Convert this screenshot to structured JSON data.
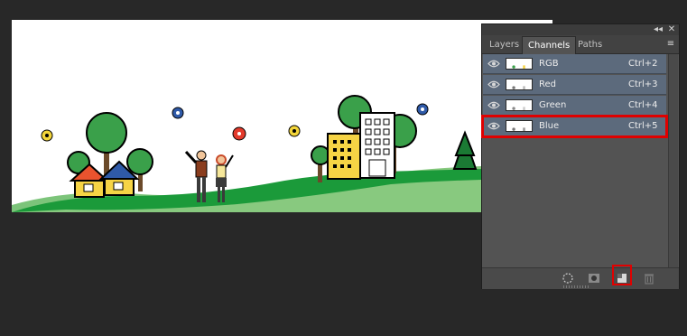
{
  "panel": {
    "tabs": [
      {
        "label": "Layers",
        "active": false
      },
      {
        "label": "Channels",
        "active": true
      },
      {
        "label": "Paths",
        "active": false
      }
    ],
    "collapse_glyph": "◂◂",
    "close_glyph": "✕",
    "menu_glyph": "≡",
    "channels": [
      {
        "name": "RGB",
        "shortcut": "Ctrl+2",
        "visible": true,
        "highlighted": false
      },
      {
        "name": "Red",
        "shortcut": "Ctrl+3",
        "visible": true,
        "highlighted": false
      },
      {
        "name": "Green",
        "shortcut": "Ctrl+4",
        "visible": true,
        "highlighted": false
      },
      {
        "name": "Blue",
        "shortcut": "Ctrl+5",
        "visible": true,
        "highlighted": true
      }
    ],
    "bottom_buttons": [
      {
        "icon": "load-selection-icon"
      },
      {
        "icon": "save-selection-icon"
      },
      {
        "icon": "new-channel-icon",
        "highlighted": true
      },
      {
        "icon": "trash-icon"
      }
    ]
  },
  "colors": {
    "app_bg": "#282828",
    "panel_bg": "#535353",
    "row_selected": "#5c6a7c",
    "highlight": "#e00000"
  }
}
